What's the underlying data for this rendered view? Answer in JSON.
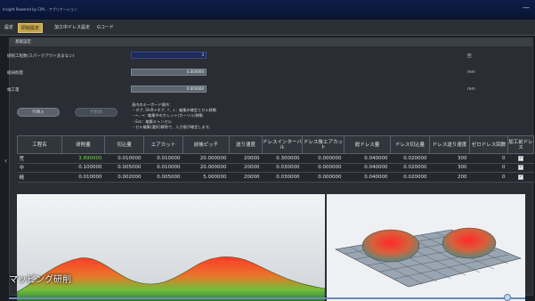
{
  "window": {
    "title": "Insight Powered by CIM... アプリケーション",
    "minimize_glyph": "—"
  },
  "tabs": [
    {
      "label": "設定",
      "active": false
    },
    {
      "label": "研削設定",
      "active": true
    },
    {
      "label": "加工中ドレス設定",
      "active": false
    },
    {
      "label": "Gコード",
      "active": false
    }
  ],
  "panel": {
    "header": "基礎設定",
    "rows": [
      {
        "label": "研削工程数(スパークアウト含まない)",
        "value": "3",
        "unit": "回"
      },
      {
        "label": "総研削量",
        "value": "4.000000",
        "unit": "mm"
      },
      {
        "label": "幅工量",
        "value": "0.000000",
        "unit": "mm"
      }
    ],
    "buttons": {
      "import": "行挿入",
      "delete": "行削除"
    },
    "help_lines": [
      "表内のキーボード操作：",
      "・タブ, Shift+タブ, ↑, ↓：編集の確定とセル移動",
      "・←, →：編集中のカレット(カーソル)移動",
      "・Esc：編集キャンセル",
      "・セル編集(選択)解除で、入力値が確定します。"
    ]
  },
  "table": {
    "columns": [
      "工程名",
      "研削量",
      "切込量",
      "エアカット",
      "前後ピッチ",
      "送り速度",
      "ドレスインターバル",
      "ドレス後エアカット",
      "総ドレス量",
      "ドレス切込量",
      "ドレス送り速度",
      "ゼロドレス回数",
      "加工前ドレス"
    ],
    "rows": [
      {
        "name": "荒",
        "cells": [
          "3.890000",
          "0.010000",
          "0.010000",
          "20.000000",
          "20000",
          "0.300000",
          "0.000000",
          "0.040000",
          "0.020000",
          "300",
          "0"
        ],
        "checked": true
      },
      {
        "name": "中",
        "cells": [
          "0.100000",
          "0.005000",
          "0.010000",
          "20.000000",
          "20000",
          "0.030000",
          "0.000000",
          "0.040000",
          "0.020000",
          "300",
          "0"
        ],
        "checked": true
      },
      {
        "name": "精",
        "cells": [
          "0.010000",
          "0.002000",
          "0.005000",
          "5.000000",
          "20000",
          "0.030000",
          "0.000000",
          "0.040000",
          "0.020000",
          "200",
          "0"
        ],
        "checked": true
      }
    ],
    "check_glyph": "✓",
    "highlight_color": "#7ad84f"
  },
  "visual": {
    "caption": "マッピング研削",
    "left_arrow": "‹"
  }
}
